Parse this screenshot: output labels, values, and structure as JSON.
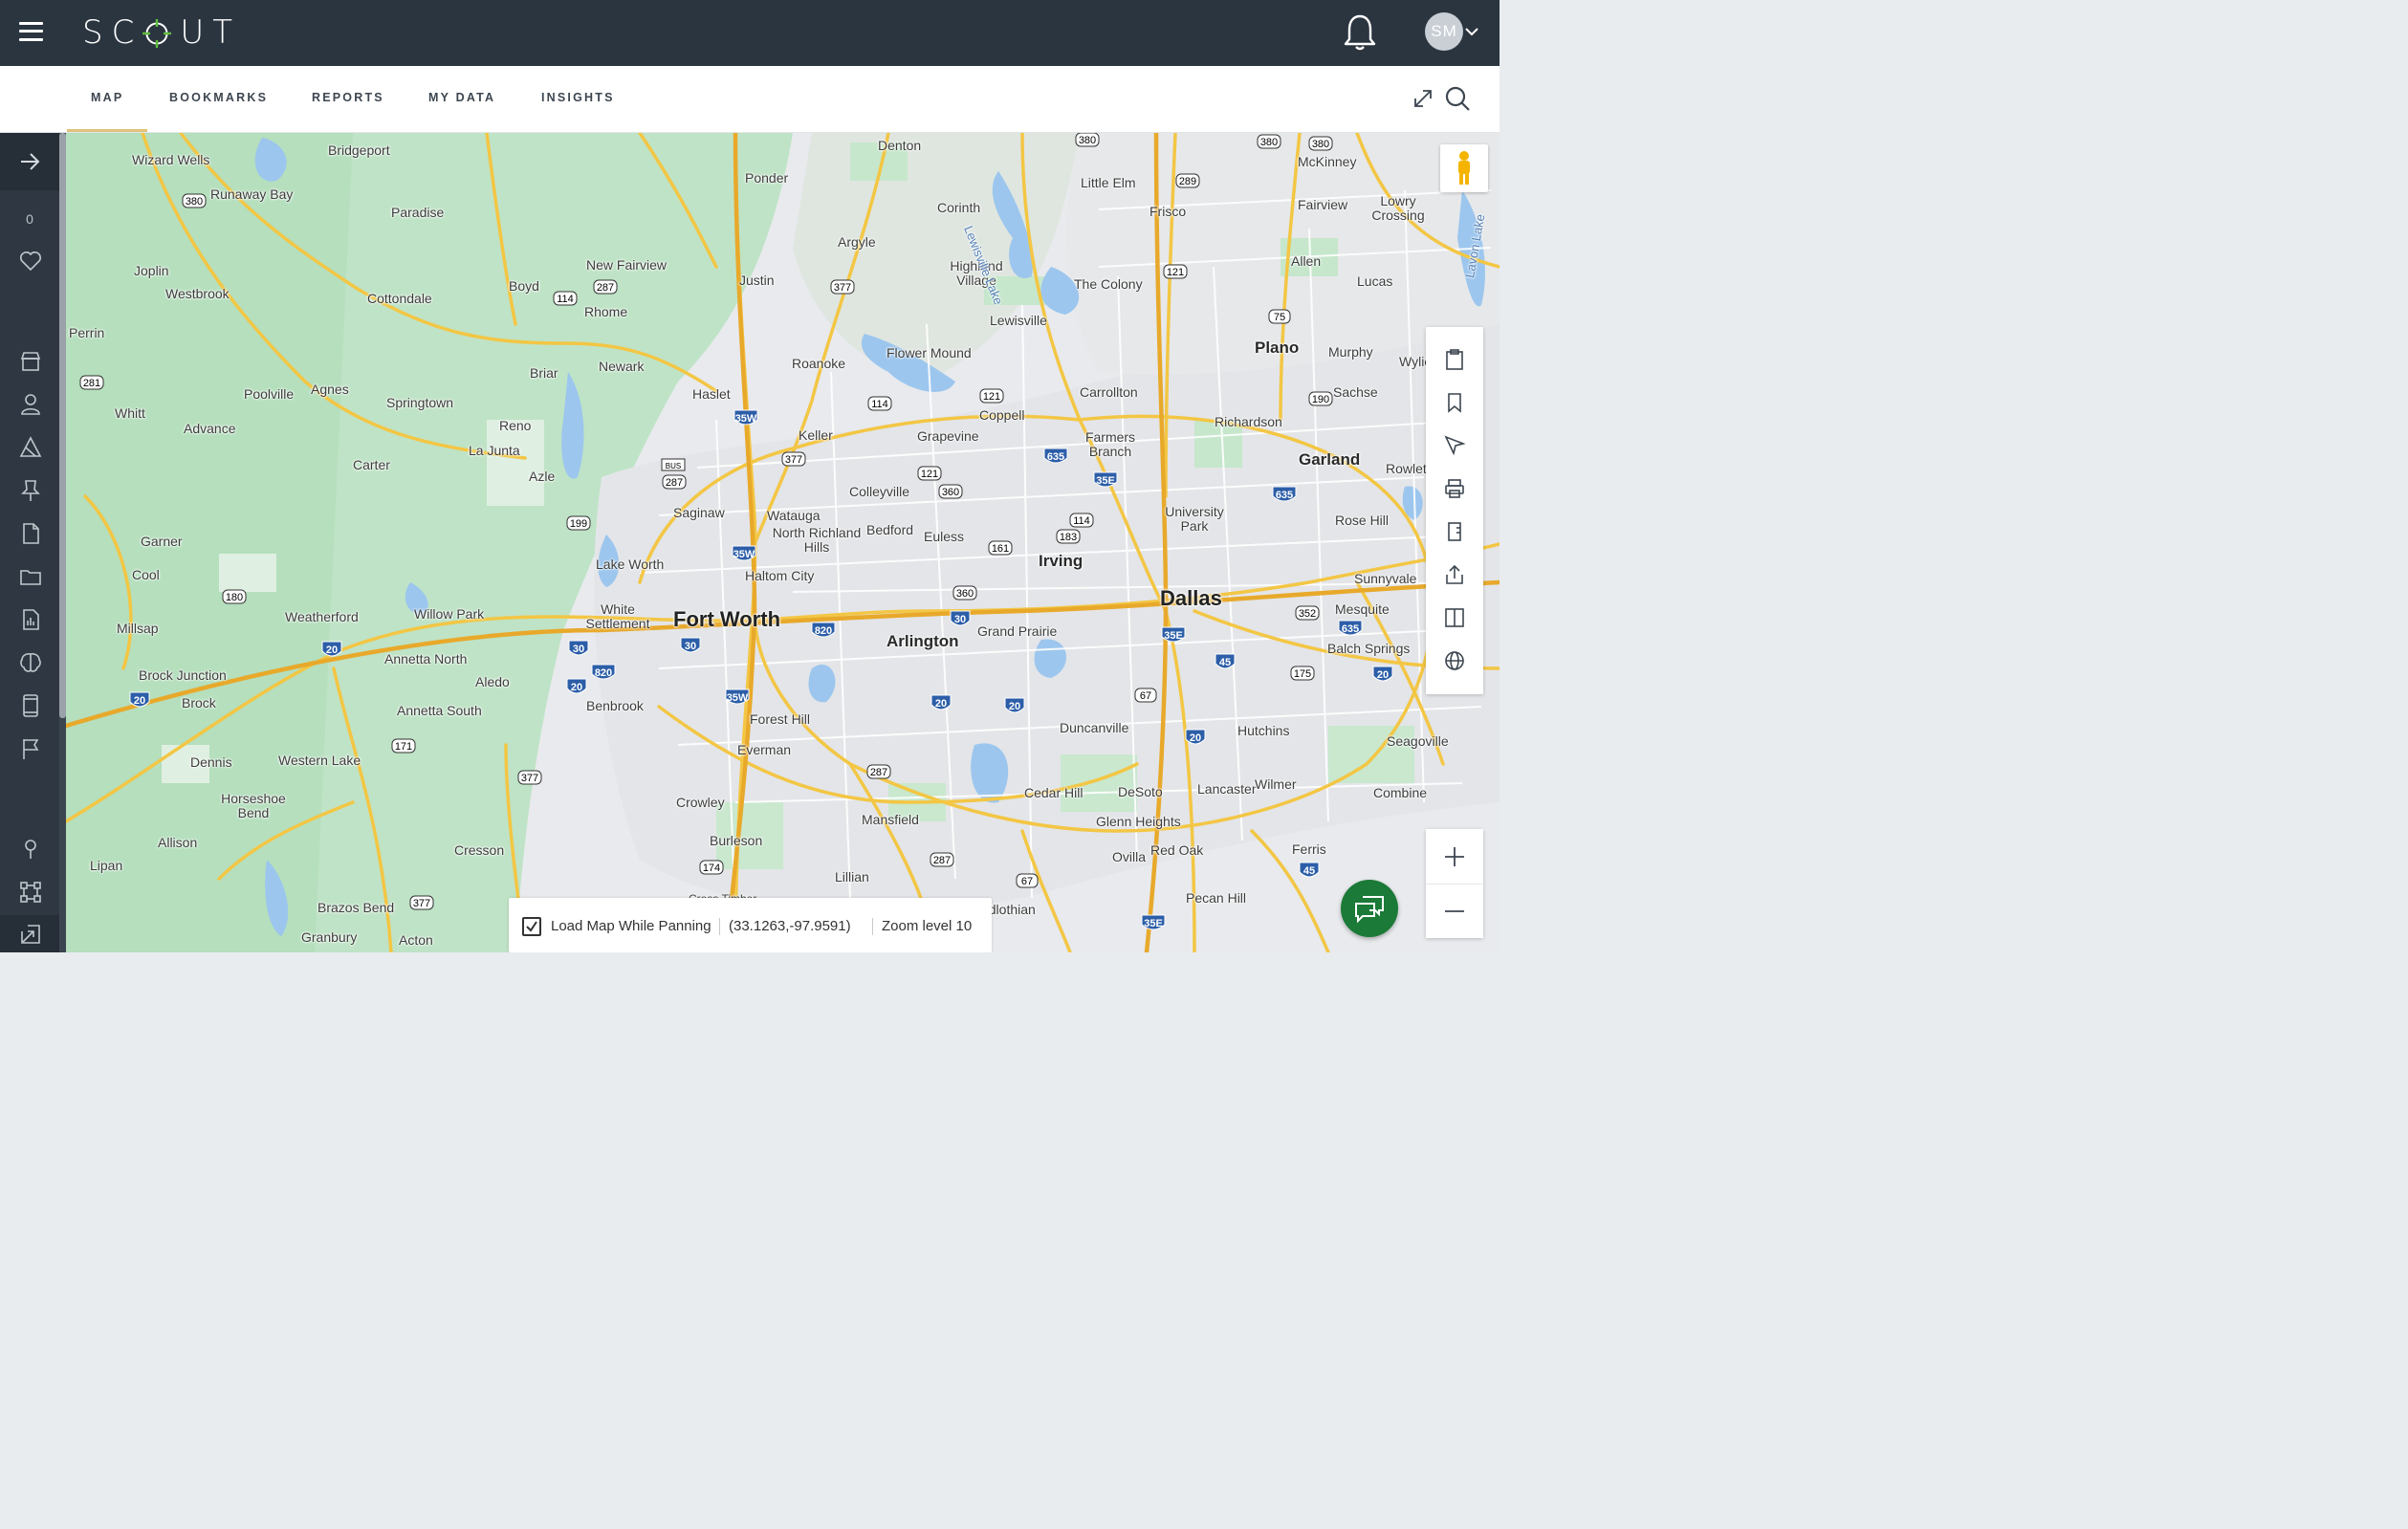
{
  "app": {
    "logo_text_start": "SC",
    "logo_text_end": "UT",
    "user_initials": "SM"
  },
  "nav": {
    "tabs": [
      {
        "label": "MAP",
        "active": true
      },
      {
        "label": "BOOKMARKS",
        "active": false
      },
      {
        "label": "REPORTS",
        "active": false
      },
      {
        "label": "MY DATA",
        "active": false
      },
      {
        "label": "INSIGHTS",
        "active": false
      }
    ]
  },
  "sidebar": {
    "count": "0",
    "icons": [
      "heart-icon",
      "store-icon",
      "person-icon",
      "polygon-icon",
      "pushpin-icon",
      "document-icon",
      "folder-icon",
      "report-icon",
      "brain-icon",
      "tablet-icon",
      "flag-icon",
      "location-pin-icon",
      "scan-icon",
      "export-icon"
    ]
  },
  "map": {
    "towns": [
      "Wizard Wells",
      "Bridgeport",
      "Runaway Bay",
      "Paradise",
      "Joplin",
      "Westbrook",
      "Cottondale",
      "Boyd",
      "New Fairview",
      "Rhome",
      "Perrin",
      "Poolville",
      "Agnes",
      "Springtown",
      "Whitt",
      "Advance",
      "Briar",
      "Newark",
      "Reno",
      "La Junta",
      "Carter",
      "Azle",
      "Garner",
      "Cool",
      "Millsap",
      "Weatherford",
      "Willow Park",
      "Annetta North",
      "Aledo",
      "Annetta South",
      "Brock Junction",
      "Brock",
      "Dennis",
      "Western Lake",
      "Horseshoe Bend",
      "Allison",
      "Lipan",
      "Cresson",
      "Brazos Bend",
      "Granbury",
      "Acton",
      "Denton",
      "Ponder",
      "Argyle",
      "Justin",
      "Corinth",
      "Highland Village",
      "Lewisville",
      "Little Elm",
      "Frisco",
      "The Colony",
      "McKinney",
      "Fairview",
      "Lowry Crossing",
      "Allen",
      "Lucas",
      "Plano",
      "Murphy",
      "Wylie",
      "Sachse",
      "Roanoke",
      "Flower Mound",
      "Haslet",
      "Keller",
      "Coppell",
      "Carrollton",
      "Grapevine",
      "Farmers Branch",
      "Richardson",
      "Garland",
      "Rowlett",
      "Colleyville",
      "Saginaw",
      "Watauga",
      "North Richland Hills",
      "Bedford",
      "Euless",
      "Irving",
      "University Park",
      "Rose Hill",
      "Sunnyvale",
      "Lake Worth",
      "Haltom City",
      "White Settlement",
      "Fort Worth",
      "Arlington",
      "Grand Prairie",
      "Dallas",
      "Mesquite",
      "Balch Springs",
      "Benbrook",
      "Forest Hill",
      "Everman",
      "Duncanville",
      "Hutchins",
      "Seagoville",
      "Crowley",
      "Cedar Hill",
      "DeSoto",
      "Lancaster",
      "Wilmer",
      "Combine",
      "Mansfield",
      "Glenn Heights",
      "Burleson",
      "Lillian",
      "Red Oak",
      "Ovilla",
      "Ferris",
      "Pecan Hill",
      "Midlothian",
      "Cross Timber"
    ],
    "water": [
      "Lewisville Lake",
      "Lavon Lake"
    ],
    "shields": [
      "380",
      "287",
      "114",
      "377",
      "121",
      "289",
      "75",
      "35W",
      "35E",
      "635",
      "820",
      "30",
      "20",
      "45",
      "360",
      "183",
      "161",
      "199",
      "180",
      "171",
      "174",
      "67",
      "175",
      "352",
      "190",
      "281",
      "BUS"
    ]
  },
  "status": {
    "load_while_panning_label": "Load Map While Panning",
    "coords": "(33.1263,-97.9591)",
    "zoom": "Zoom level 10"
  }
}
